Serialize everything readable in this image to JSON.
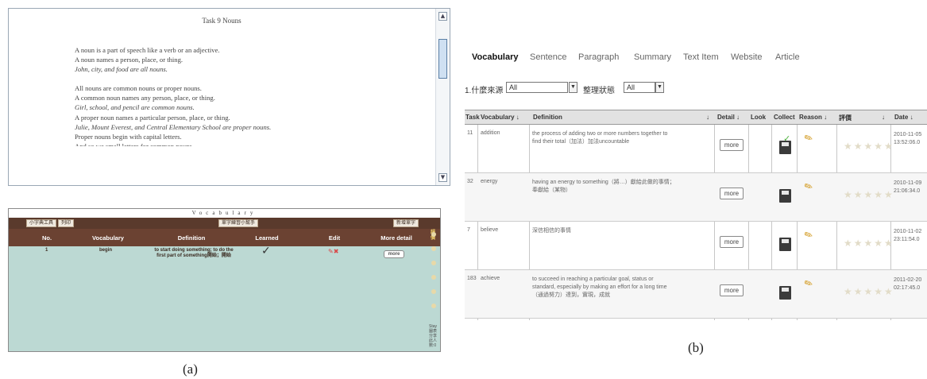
{
  "reading": {
    "title": "Task 9 Nouns",
    "lines": [
      "A noun is a part of speech like a verb or an adjective.",
      "A noun names a person, place, or thing.",
      "John, city, and food are all nouns.",
      "",
      "All nouns are common nouns or proper nouns.",
      "A common noun names any person, place, or thing.",
      "Girl, school, and pencil are common nouns.",
      "A proper noun names a particular person, place, or thing.",
      "Julie, Mount Everest, and Central Elementary School are proper nouns.",
      "Proper nouns begin with capital letters.",
      "And so we small letters for common nouns."
    ],
    "scroll_up": "▲",
    "scroll_down": "▼"
  },
  "vocab": {
    "title": "Vocabulary",
    "toolbar": {
      "btn1": "小字典工具",
      "btn2": "列印",
      "btn3": "單字練習小幫手",
      "btn4": "新增單字"
    },
    "headers": {
      "no": "No.",
      "vocabulary": "Vocabulary",
      "definition": "Definition",
      "learned": "Learned",
      "edit": "Edit",
      "more": "More detail"
    },
    "side_header": "評價",
    "rows": [
      {
        "no": "1",
        "word": "begin",
        "definition": "to start doing something; to do the first part of something開始；開始",
        "learned": "✓",
        "more": "more"
      }
    ],
    "side_text": "Stay 圖表 分享 此人 數:0"
  },
  "captions": {
    "a": "(a)",
    "b": "(b)"
  },
  "tabs": [
    "Vocabulary",
    "Sentence",
    "Paragraph",
    "Summary",
    "Text Item",
    "Website",
    "Article"
  ],
  "filters": {
    "label1": "1.什麼來源",
    "value1": "All",
    "label2": "整理狀態",
    "value2": "All"
  },
  "table": {
    "headers": {
      "task": "Task",
      "vocabulary": "Vocabulary ↓",
      "definition": "Definition",
      "sort_def": "↓",
      "detail": "Detail ↓",
      "look": "Look",
      "collect": "Collect",
      "reason": "Reason ↓",
      "rating": "評價",
      "sort_rating": "↓",
      "date": "Date ↓"
    },
    "rows": [
      {
        "task": "11",
        "word": "addition",
        "definition": "the process of adding two or more numbers together to find their total（加法）加法uncountable",
        "more": "more",
        "checked": true,
        "stars": "★★★★★",
        "date": "2010-11-05 13:52:06.0"
      },
      {
        "task": "32",
        "word": "energy",
        "definition": "having an energy to something（將…）獻給此做的事情；奉獻給（某物）",
        "more": "more",
        "checked": false,
        "stars": "★★★★★",
        "date": "2010-11-09 21:06:34.0"
      },
      {
        "task": "7",
        "word": "believe",
        "definition": "深信相信的事情",
        "more": "more",
        "checked": false,
        "stars": "★★★★★",
        "date": "2010-11-02 23:11:54.0"
      },
      {
        "task": "183",
        "word": "achieve",
        "definition": "to succeed in reaching a particular goal, status or standard, especially by making an effort for a long time（通過努力）達到，實現，成就",
        "more": "more",
        "checked": false,
        "stars": "★★★★★",
        "date": "2011-02-20 02:17:45.0"
      }
    ]
  }
}
